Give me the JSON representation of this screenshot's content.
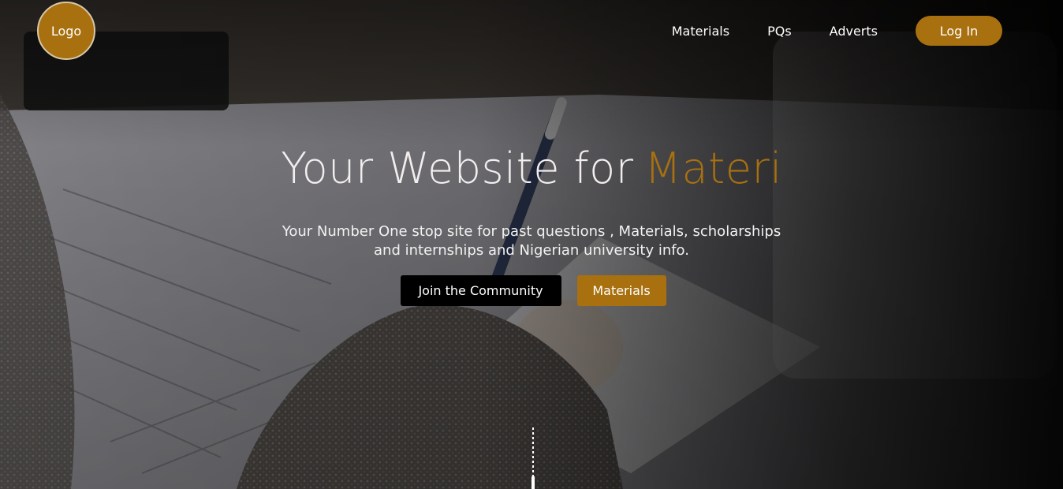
{
  "brand": {
    "logo_text": "Logo",
    "accent_color": "#a8700f"
  },
  "nav": {
    "items": [
      {
        "label": "Materials"
      },
      {
        "label": "PQs"
      },
      {
        "label": "Adverts"
      }
    ],
    "login_label": "Log In"
  },
  "hero": {
    "headline_main": "Your Website for",
    "headline_accent": "Materi",
    "subtext_line1": "Your Number One stop site for past questions , Materials, scholarships",
    "subtext_line2": "and internships and Nigerian university info.",
    "primary_button": "Join the Community",
    "secondary_button": "Materials"
  },
  "icons": {
    "scroll_indicator": "scroll-down-indicator"
  }
}
